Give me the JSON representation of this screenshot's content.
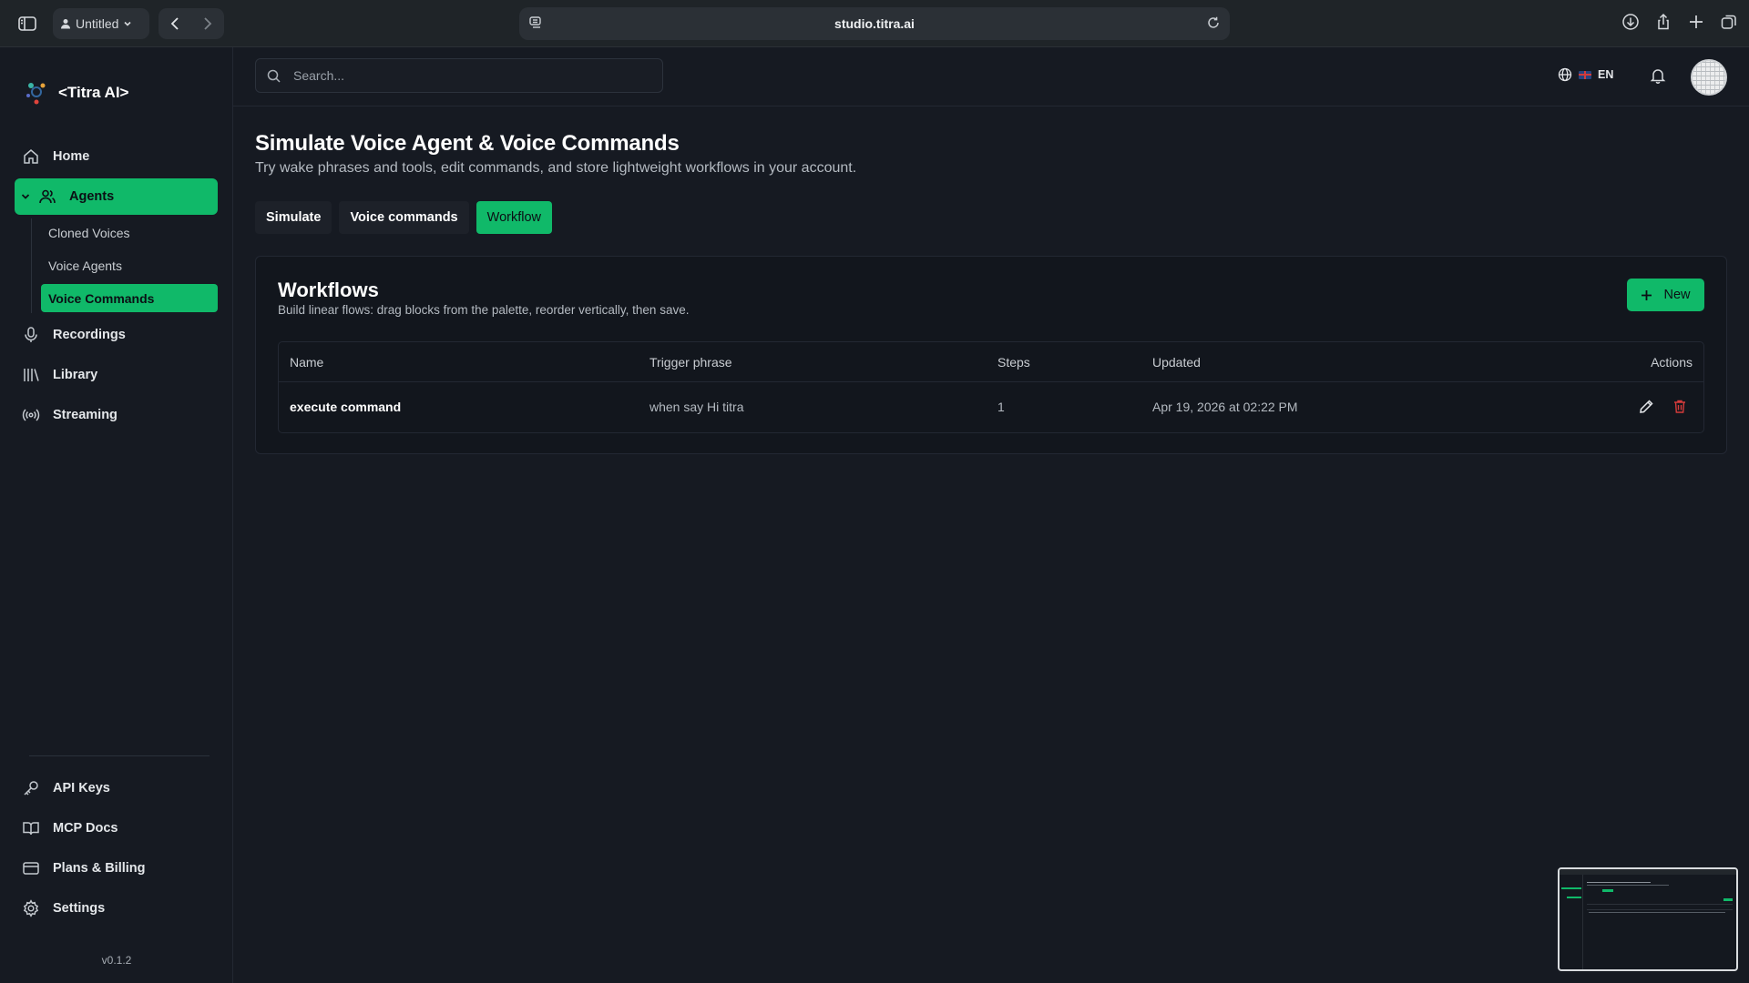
{
  "browser": {
    "profile_label": "Untitled",
    "url": "studio.titra.ai"
  },
  "brand": {
    "name": "<Titra AI>"
  },
  "sidebar": {
    "items": [
      {
        "label": "Home",
        "icon": "home-icon"
      },
      {
        "label": "Agents",
        "icon": "users-icon",
        "expanded": true,
        "active": true
      },
      {
        "label": "Recordings",
        "icon": "microphone-icon"
      },
      {
        "label": "Library",
        "icon": "library-icon"
      },
      {
        "label": "Streaming",
        "icon": "broadcast-icon"
      }
    ],
    "agent_subitems": [
      {
        "label": "Cloned Voices"
      },
      {
        "label": "Voice Agents"
      },
      {
        "label": "Voice Commands",
        "active": true
      }
    ],
    "bottom_items": [
      {
        "label": "API Keys",
        "icon": "key-icon"
      },
      {
        "label": "MCP Docs",
        "icon": "book-icon"
      },
      {
        "label": "Plans & Billing",
        "icon": "credit-card-icon"
      },
      {
        "label": "Settings",
        "icon": "gear-icon"
      }
    ],
    "version": "v0.1.2"
  },
  "topbar": {
    "search_placeholder": "Search...",
    "language": "EN"
  },
  "page": {
    "title": "Simulate Voice Agent & Voice Commands",
    "subtitle": "Try wake phrases and tools, edit commands, and store lightweight workflows in your account.",
    "tabs": [
      {
        "label": "Simulate"
      },
      {
        "label": "Voice commands"
      },
      {
        "label": "Workflow",
        "active": true
      }
    ]
  },
  "workflows": {
    "title": "Workflows",
    "subtitle": "Build linear flows: drag blocks from the palette, reorder vertically, then save.",
    "new_label": "New",
    "columns": {
      "name": "Name",
      "trigger": "Trigger phrase",
      "steps": "Steps",
      "updated": "Updated",
      "actions": "Actions"
    },
    "rows": [
      {
        "name": "execute command",
        "trigger": "when say Hi titra",
        "steps": "1",
        "updated": "Apr 19, 2026 at 02:22 PM"
      }
    ]
  },
  "colors": {
    "accent": "#10b969",
    "background": "#161a22",
    "danger": "#d63b3b"
  }
}
